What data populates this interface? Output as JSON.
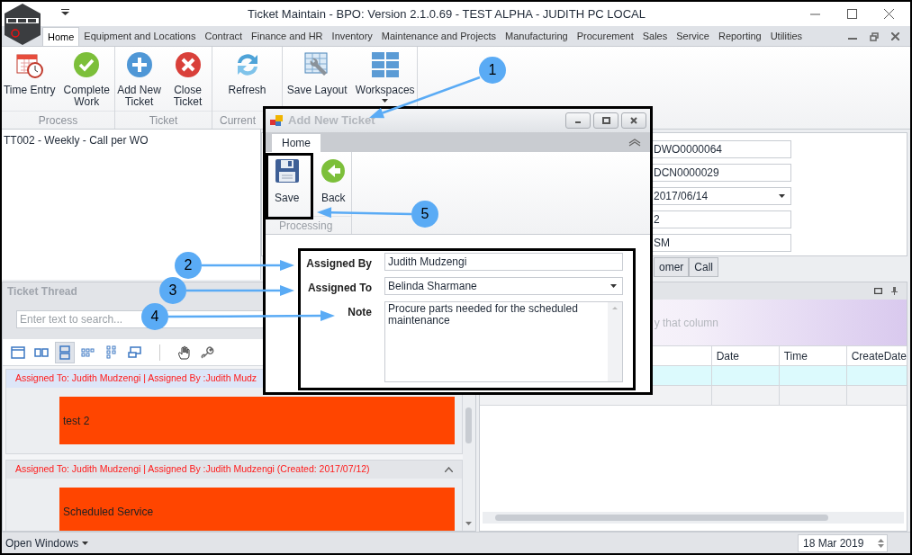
{
  "window": {
    "title": "Ticket Maintain - BPO: Version 2.1.0.69 - TEST ALPHA - JUDITH PC LOCAL"
  },
  "ribbon_tabs": [
    {
      "label": "Home",
      "selected": true
    },
    {
      "label": "Equipment and Locations",
      "selected": false
    },
    {
      "label": "Contract",
      "selected": false
    },
    {
      "label": "Finance and HR",
      "selected": false
    },
    {
      "label": "Inventory",
      "selected": false
    },
    {
      "label": "Maintenance and Projects",
      "selected": false
    },
    {
      "label": "Manufacturing",
      "selected": false
    },
    {
      "label": "Procurement",
      "selected": false
    },
    {
      "label": "Sales",
      "selected": false
    },
    {
      "label": "Service",
      "selected": false
    },
    {
      "label": "Reporting",
      "selected": false
    },
    {
      "label": "Utilities",
      "selected": false
    }
  ],
  "ribbon_groups": [
    {
      "label": "Process",
      "buttons": [
        {
          "label": "Time Entry"
        },
        {
          "label": "Complete Work"
        }
      ]
    },
    {
      "label": "Ticket",
      "buttons": [
        {
          "label": "Add New Ticket"
        },
        {
          "label": "Close Ticket"
        }
      ]
    },
    {
      "label": "Current",
      "buttons": [
        {
          "label": "Refresh"
        }
      ]
    },
    {
      "buttons": [
        {
          "label": "Save Layout"
        },
        {
          "label": "Workspaces",
          "dropdown": true
        }
      ]
    }
  ],
  "record_title": "TT002 - Weekly - Call per WO",
  "detail_fields": [
    {
      "value": "DWO0000064",
      "kind": "text"
    },
    {
      "value": "DCN0000029",
      "kind": "text"
    },
    {
      "value": "2017/06/14",
      "kind": "dropdown"
    },
    {
      "value": "2",
      "kind": "text"
    },
    {
      "value": "SM",
      "kind": "text"
    }
  ],
  "detail_tabs": [
    {
      "label": "omer",
      "selected": false
    },
    {
      "label": "Call",
      "selected": false
    }
  ],
  "ticket_thread": {
    "title": "Ticket Thread",
    "search_placeholder": "Enter text to search...",
    "toolbar": [
      {
        "selected": false
      },
      {
        "selected": false
      },
      {
        "selected": true
      },
      {
        "selected": false
      },
      {
        "selected": false
      },
      {
        "selected": false
      },
      {
        "selected": false
      },
      {
        "selected": false
      }
    ],
    "entries": [
      {
        "header": "Assigned To: Judith Mudzengi | Assigned By :Judith Mudz",
        "body": "test 2",
        "selected": true
      },
      {
        "header": "Assigned To: Judith Mudzengi | Assigned By :Judith Mudzengi (Created: 2017/07/12)",
        "body": "Scheduled Service",
        "selected": false
      }
    ]
  },
  "grid": {
    "group_hint": "y that column",
    "columns": [
      {
        "label": "Date"
      },
      {
        "label": "Time"
      },
      {
        "label": "CreateDate"
      }
    ],
    "rows": [
      {
        "selected": true
      },
      {
        "selected": false
      }
    ]
  },
  "status_bar": {
    "open_windows": "Open Windows",
    "date": "18 Mar 2019"
  },
  "dialog": {
    "title": "Add New Ticket",
    "tabs": [
      {
        "label": "Home",
        "selected": true
      }
    ],
    "buttons": [
      {
        "label": "Save"
      },
      {
        "label": "Back"
      }
    ],
    "group_label": "Processing",
    "fields": [
      {
        "label": "Assigned By",
        "value": "Judith Mudzengi",
        "kind": "text"
      },
      {
        "label": "Assigned To",
        "value": "Belinda Sharmane",
        "kind": "dropdown"
      },
      {
        "label": "Note",
        "value": "Procure parts needed for the scheduled maintenance",
        "kind": "memo"
      }
    ]
  },
  "callouts": [
    {
      "number": "1"
    },
    {
      "number": "2"
    },
    {
      "number": "3"
    },
    {
      "number": "4"
    },
    {
      "number": "5"
    }
  ]
}
